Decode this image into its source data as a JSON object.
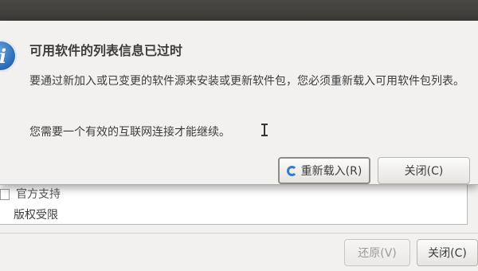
{
  "parent_window": {
    "list_items": [
      "官方支持",
      "版权受限"
    ],
    "buttons": {
      "revert": "还原(V)",
      "close": "关闭(C)"
    }
  },
  "dialog": {
    "title": "可用软件的列表信息已过时",
    "body": "要通过新加入或已变更的软件源来安装或更新软件包，您必须重新载入可用软件包列表。",
    "note": "您需要一个有效的互联网连接才能继续。",
    "icon": "info-icon",
    "buttons": {
      "reload": "重新载入(R)",
      "close": "关闭(C)"
    }
  }
}
